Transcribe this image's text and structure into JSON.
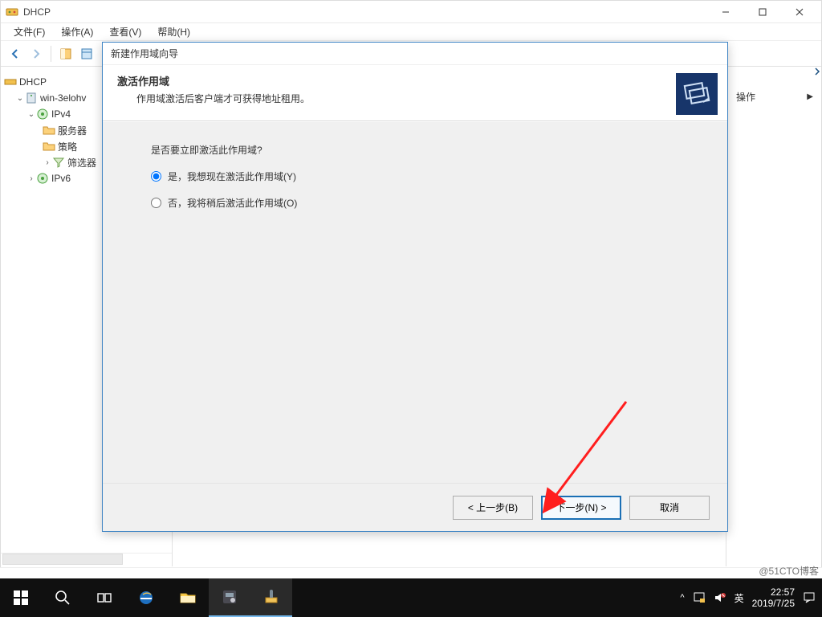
{
  "app": {
    "title": "DHCP"
  },
  "menus": {
    "file": "文件(F)",
    "action": "操作(A)",
    "view": "查看(V)",
    "help": "帮助(H)"
  },
  "tree": {
    "root": "DHCP",
    "server": "win-3elohv",
    "ipv4": "IPv4",
    "ipv4_children": {
      "server_options": "服务器",
      "policies": "策略",
      "filters": "筛选器"
    },
    "ipv6": "IPv6"
  },
  "actions_pane": {
    "more_ops": "操作"
  },
  "wizard": {
    "window_title": "新建作用域向导",
    "heading": "激活作用域",
    "subheading": "作用域激活后客户端才可获得地址租用。",
    "prompt": "是否要立即激活此作用域?",
    "opt_yes": "是，我想现在激活此作用域(Y)",
    "opt_no": "否，我将稍后激活此作用域(O)",
    "btn_back": "< 上一步(B)",
    "btn_next": "下一步(N) >",
    "btn_cancel": "取消"
  },
  "taskbar": {
    "ime": "英",
    "time": "22:57",
    "date": "2019/7/25"
  },
  "watermark": "@51CTO博客"
}
